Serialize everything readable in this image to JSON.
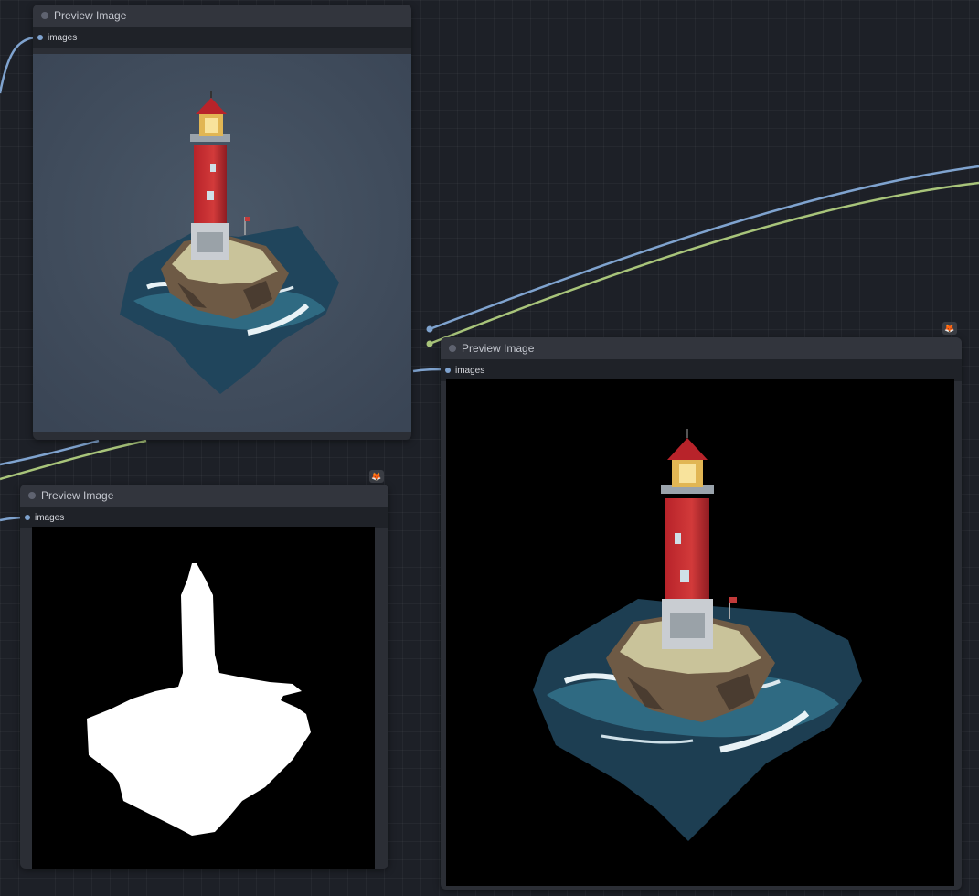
{
  "colors": {
    "canvas_bg": "#1d2027",
    "node_bg": "#2b2e35",
    "link_image": "#7fa3cf",
    "link_mask": "#a8c47a"
  },
  "nodes": [
    {
      "title": "Preview Image",
      "input_label": "images",
      "badge_icon": "fox-icon"
    },
    {
      "title": "Preview Image",
      "input_label": "images",
      "badge_icon": "fox-icon"
    },
    {
      "title": "Preview Image",
      "input_label": "images",
      "badge_icon": "fox-icon"
    }
  ]
}
